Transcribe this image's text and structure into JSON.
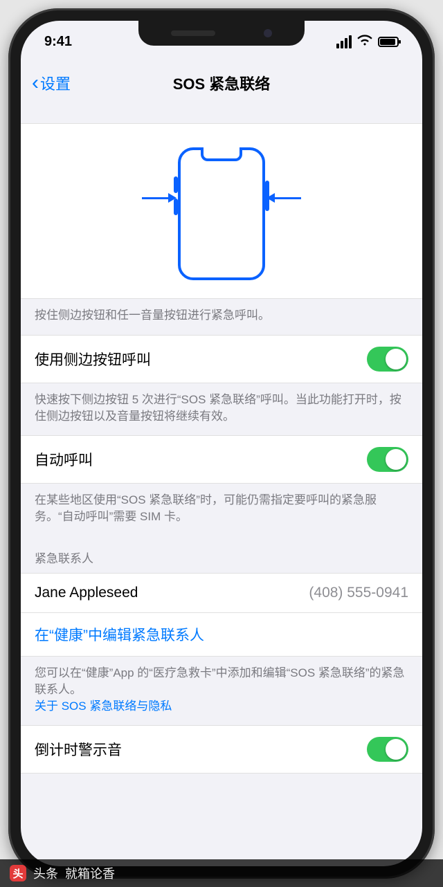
{
  "statusbar": {
    "time": "9:41"
  },
  "nav": {
    "back_label": "设置",
    "title": "SOS 紧急联络"
  },
  "illustration_footer": "按住侧边按钮和任一音量按钮进行紧急呼叫。",
  "rows": {
    "side_button": {
      "label": "使用侧边按钮呼叫",
      "footer": "快速按下侧边按钮 5 次进行“SOS 紧急联络”呼叫。当此功能打开时，按住侧边按钮以及音量按钮将继续有效。"
    },
    "auto_call": {
      "label": "自动呼叫",
      "footer": "在某些地区使用“SOS 紧急联络”时，可能仍需指定要呼叫的紧急服务。“自动呼叫”需要 SIM 卡。"
    },
    "contacts_header": "紧急联系人",
    "contact": {
      "name": "Jane Appleseed",
      "phone": "(408) 555-0941"
    },
    "edit_link": "在“健康”中编辑紧急联系人",
    "contacts_footer": "您可以在“健康”App 的“医疗急救卡”中添加和编辑“SOS 紧急联络”的紧急联系人。",
    "privacy_link": "关于 SOS 紧急联络与隐私",
    "countdown": {
      "label": "倒计时警示音"
    }
  },
  "attribution": {
    "source": "头条",
    "author": "就箱论香"
  }
}
